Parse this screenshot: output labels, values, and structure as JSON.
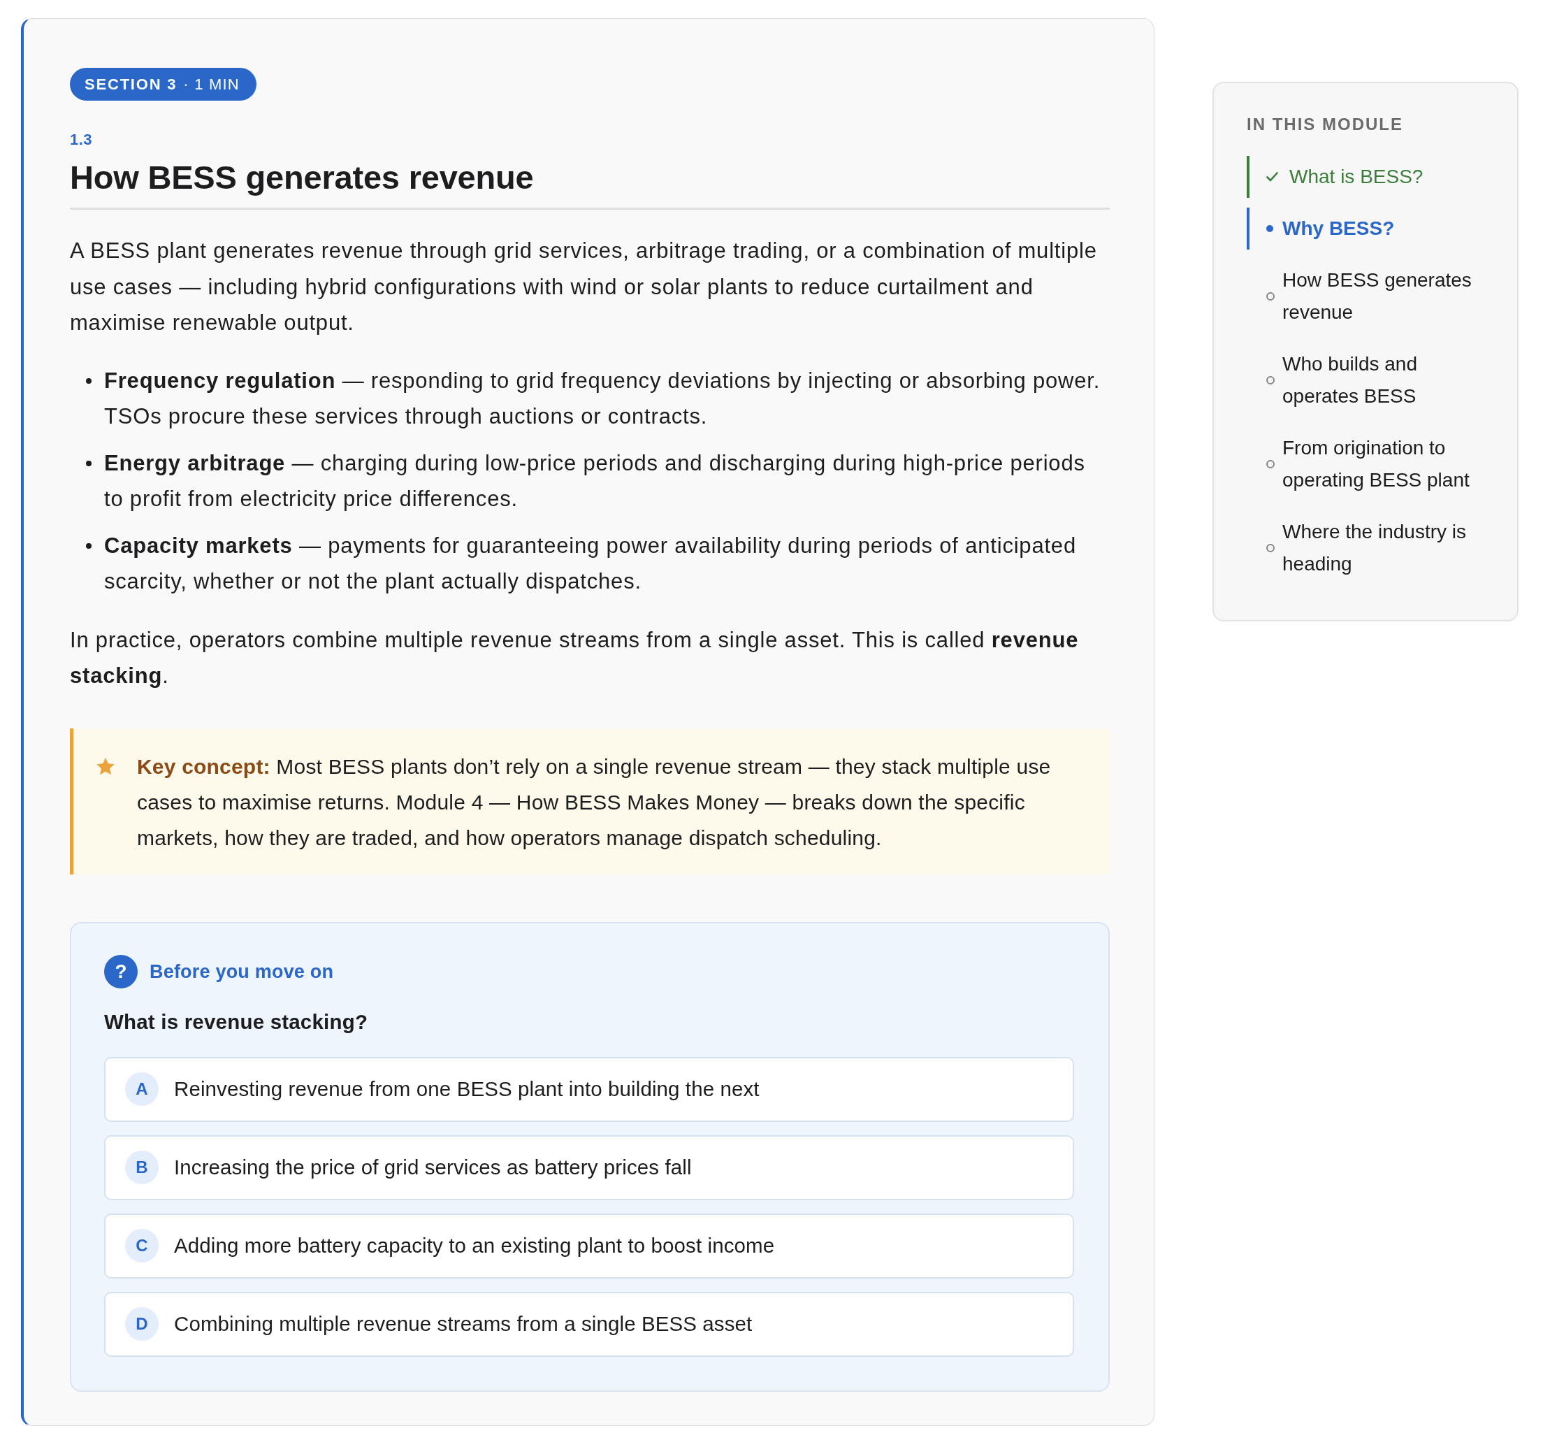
{
  "section_badge": {
    "label": "SECTION 3",
    "duration": "· 1 MIN"
  },
  "lesson": {
    "number": "1.3",
    "title": "How BESS generates revenue",
    "intro": "A BESS plant generates revenue through grid services, arbitrage trading, or a combination of multiple use cases — including hybrid configurations with wind or solar plants to reduce curtailment and maximise renewable output.",
    "bullets": [
      "**Frequency regulation** — responding to grid frequency deviations by injecting or absorbing power. TSOs procure these services through auctions or contracts.",
      "**Energy arbitrage** — charging during low-price periods and discharging during high-price periods to profit from electricity price differences.",
      "**Capacity markets** — payments for guaranteeing power availability during periods of anticipated scarcity, whether or not the plant actually dispatches."
    ],
    "closing": "In practice, operators combine multiple revenue streams from a single asset. This is called **revenue stacking**.",
    "callout": {
      "text": "**Key concept:** Most BESS plants don’t rely on a single revenue stream — they stack multiple use cases to maximise returns. Module 4 — How BESS Makes Money — breaks down the specific markets, how they are traded, and how operators manage dispatch scheduling."
    },
    "quiz": {
      "icon": "?",
      "heading": "Before you move on",
      "question": "What is revenue stacking?",
      "options": [
        {
          "letter": "A",
          "text": "Reinvesting revenue from one BESS plant into building the next",
          "selected": false
        },
        {
          "letter": "B",
          "text": "Increasing the price of grid services as battery prices fall",
          "selected": false
        },
        {
          "letter": "C",
          "text": "Adding more battery capacity to an existing plant to boost income",
          "selected": false
        },
        {
          "letter": "D",
          "text": "Combining multiple revenue streams from a single BESS asset",
          "selected": false
        }
      ]
    }
  },
  "sidebar": {
    "heading": "IN THIS MODULE",
    "items": [
      {
        "label": "What is BESS?",
        "completed": true,
        "selected": false
      },
      {
        "label": "Why BESS?",
        "completed": false,
        "selected": true
      },
      {
        "label": "How BESS generates revenue",
        "completed": false,
        "selected": false
      },
      {
        "label": "Who builds and operates BESS",
        "completed": false,
        "selected": false
      },
      {
        "label": "From origination to operating BESS plant",
        "completed": false,
        "selected": false
      },
      {
        "label": "Where the industry is heading",
        "completed": false,
        "selected": false
      }
    ]
  }
}
